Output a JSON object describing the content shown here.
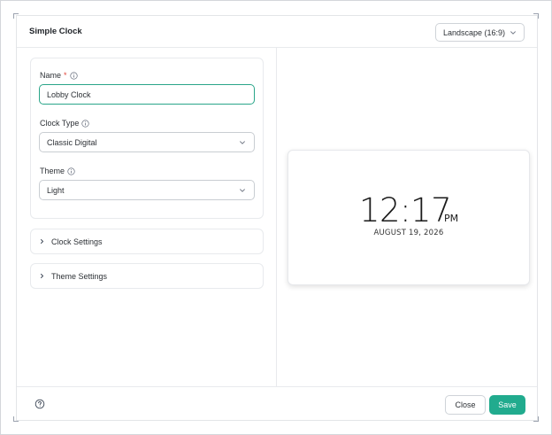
{
  "header": {
    "title": "Simple Clock",
    "layout_select": "Landscape (16:9)"
  },
  "form": {
    "name_label": "Name",
    "name_required_mark": "*",
    "name_value": "Lobby Clock",
    "clock_type_label": "Clock Type",
    "clock_type_value": "Classic Digital",
    "theme_label": "Theme",
    "theme_value": "Light"
  },
  "sections": {
    "clock_settings": "Clock Settings",
    "theme_settings": "Theme Settings"
  },
  "preview": {
    "time": "12:17",
    "ampm": "PM",
    "date": "AUGUST 19, 2026"
  },
  "footer": {
    "close_label": "Close",
    "save_label": "Save"
  },
  "colors": {
    "accent": "#21ab8e",
    "focus_border": "#2aa589",
    "required": "#e0453a"
  },
  "icons": {
    "select_chevron": "chevron-down-icon",
    "info": "info-icon",
    "accordion": "chevron-right-icon",
    "help": "help-circle-icon"
  }
}
